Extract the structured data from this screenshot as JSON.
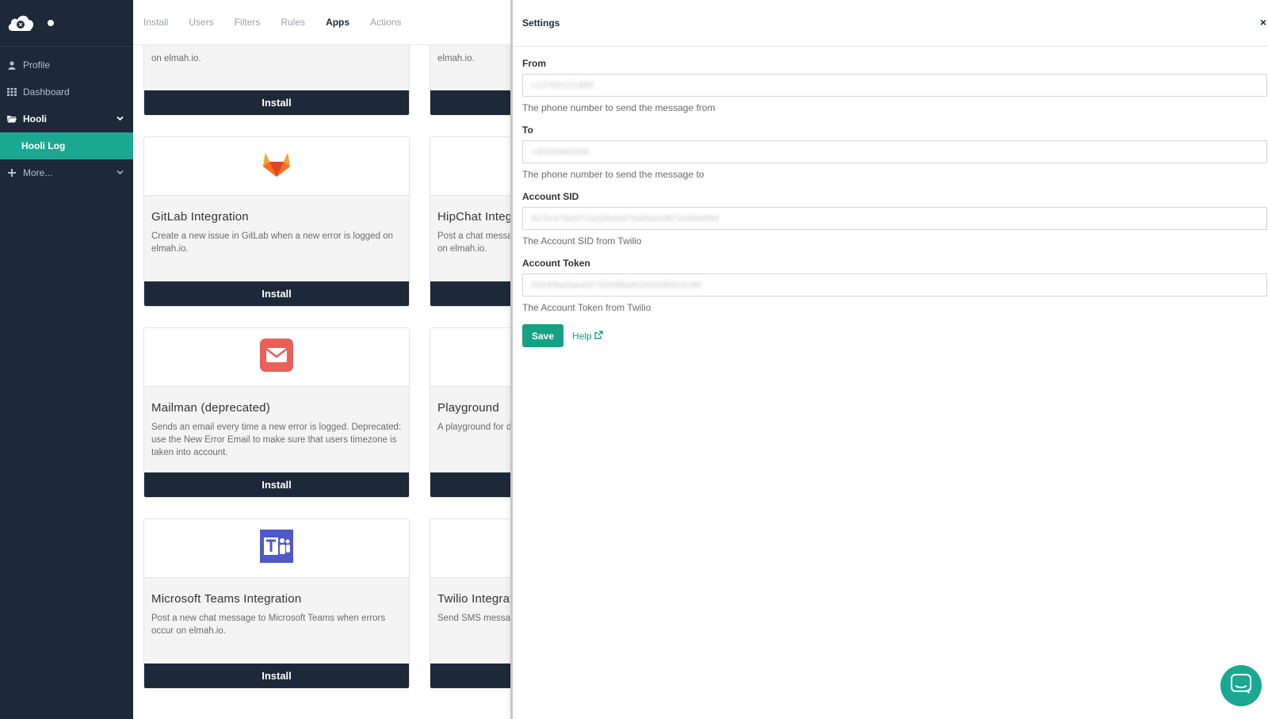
{
  "sidebar": {
    "items": [
      {
        "label": "Profile",
        "icon": "user-icon"
      },
      {
        "label": "Dashboard",
        "icon": "grid-icon"
      },
      {
        "label": "Hooli",
        "icon": "folder-icon"
      },
      {
        "label": "Hooli Log"
      },
      {
        "label": "More...",
        "icon": "plus-icon"
      }
    ]
  },
  "tabs": [
    {
      "label": "Install"
    },
    {
      "label": "Users"
    },
    {
      "label": "Filters"
    },
    {
      "label": "Rules"
    },
    {
      "label": "Apps"
    },
    {
      "label": "Actions"
    }
  ],
  "cards": {
    "top_left": {
      "desc_line": "on elmah.io.",
      "install": "Install"
    },
    "top_right": {
      "desc_line": "elmah.io."
    },
    "gitlab": {
      "title": "GitLab Integration",
      "desc": "Create a new issue in GitLab when a new error is logged on elmah.io.",
      "install": "Install",
      "icon": "gitlab-icon"
    },
    "hipchat": {
      "title": "HipChat Integration",
      "desc": "Post a chat message to HipChat when a new error is logged on elmah.io."
    },
    "mailman": {
      "title": "Mailman (deprecated)",
      "desc": "Sends an email every time a new error is logged. Deprecated: use the New Error Email to make sure that users timezone is taken into account.",
      "install": "Install",
      "icon": "mail-icon"
    },
    "playground": {
      "title": "Playground",
      "desc": "A playground for demonstrating the various possibilities"
    },
    "teams": {
      "title": "Microsoft Teams Integration",
      "desc": "Post a new chat message to Microsoft Teams when errors occur on elmah.io.",
      "install": "Install",
      "icon": "teams-icon"
    },
    "twilio": {
      "title": "Twilio Integration",
      "desc": "Send SMS messages when errors are logged on elmah.io."
    }
  },
  "settings": {
    "title": "Settings",
    "close": "×",
    "fields": [
      {
        "label": "From",
        "value": "+12762121885",
        "help": "The phone number to send the message from"
      },
      {
        "label": "To",
        "value": "+4528345269",
        "help": "The phone number to send the message to"
      },
      {
        "label": "Account SID",
        "value": "AC5c47be072a226d2d7bef6e43872c9b6999",
        "help": "The Account SID from Twilio"
      },
      {
        "label": "Account Token",
        "value": "5904f6e0ae4971f2f4f6a8328429f3c5c85",
        "help": "The Account Token from Twilio"
      }
    ],
    "save_label": "Save",
    "help_label": "Help"
  },
  "colors": {
    "sidebar_bg": "#1d2939",
    "accent": "#1aa893",
    "install_bg": "#1d2939"
  }
}
